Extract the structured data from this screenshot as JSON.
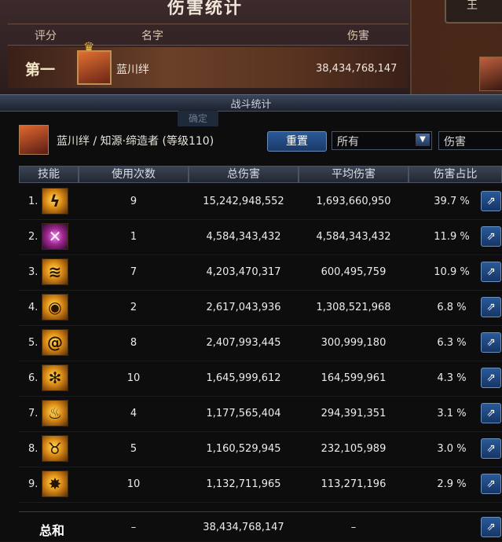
{
  "top_panel": {
    "title": "伤害统计",
    "headers": {
      "score": "评分",
      "name": "名字",
      "damage": "伤害"
    },
    "rank": "第一",
    "name": "蓝川绊",
    "damage": "38,434,768,147",
    "side_tab": "王"
  },
  "window": {
    "title": "战斗统计",
    "ghost_button": "确定",
    "character": "蓝川绊 / 知源·缔造者 (等级110)",
    "reset_label": "重置",
    "filter_value": "所有",
    "metric_value": "伤害"
  },
  "table": {
    "headers": [
      "技能",
      "使用次数",
      "总伤害",
      "平均伤害",
      "伤害占比"
    ],
    "rows": [
      {
        "index": "1.",
        "icon": "lightning-strike-icon",
        "uses": "9",
        "total": "15,242,948,552",
        "avg": "1,693,660,950",
        "pct": "39.7 %"
      },
      {
        "index": "2.",
        "icon": "crossed-swords-icon",
        "uses": "1",
        "total": "4,584,343,432",
        "avg": "4,584,343,432",
        "pct": "11.9 %"
      },
      {
        "index": "3.",
        "icon": "wave-slash-icon",
        "uses": "7",
        "total": "4,203,470,317",
        "avg": "600,495,759",
        "pct": "10.9 %"
      },
      {
        "index": "4.",
        "icon": "eye-seal-icon",
        "uses": "2",
        "total": "2,617,043,936",
        "avg": "1,308,521,968",
        "pct": "6.8 %"
      },
      {
        "index": "5.",
        "icon": "whirlwind-icon",
        "uses": "8",
        "total": "2,407,993,445",
        "avg": "300,999,180",
        "pct": "6.3 %"
      },
      {
        "index": "6.",
        "icon": "gear-burst-icon",
        "uses": "10",
        "total": "1,645,999,612",
        "avg": "164,599,961",
        "pct": "4.3 %"
      },
      {
        "index": "7.",
        "icon": "flame-hand-icon",
        "uses": "4",
        "total": "1,177,565,404",
        "avg": "294,391,351",
        "pct": "3.1 %"
      },
      {
        "index": "8.",
        "icon": "horned-beast-icon",
        "uses": "5",
        "total": "1,160,529,945",
        "avg": "232,105,989",
        "pct": "3.0 %"
      },
      {
        "index": "9.",
        "icon": "spark-burst-icon",
        "uses": "10",
        "total": "1,132,711,965",
        "avg": "113,271,196",
        "pct": "2.9 %"
      }
    ],
    "summary": {
      "label": "总和",
      "uses": "–",
      "total": "38,434,768,147",
      "avg": "–"
    }
  },
  "colors": {
    "accent_blue": "#2a5a98",
    "panel_dark": "#0d0d0e",
    "skill_gold": "#e09018"
  }
}
